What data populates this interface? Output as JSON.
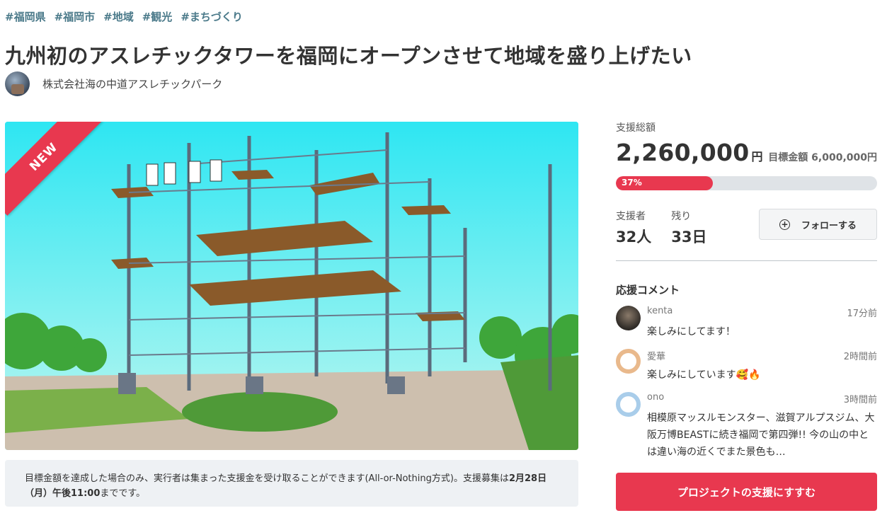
{
  "tags": [
    "#福岡県",
    "#福岡市",
    "#地域",
    "#観光",
    "#まちづくり"
  ],
  "title": "九州初のアスレチックタワーを福岡にオープンさせて地域を盛り上げたい",
  "owner": {
    "name": "株式会社海の中道アスレチックパーク"
  },
  "hero": {
    "badge": "NEW"
  },
  "notice": {
    "text_part1": "目標金額を達成した場合のみ、実行者は集まった支援金を受け取ることができます(All-or-Nothing方式)。支援募集は",
    "deadline": "2月28日（月）午後11:00",
    "text_part2": "までです。"
  },
  "funding": {
    "total_label": "支援総額",
    "total_amount": "2,260,000",
    "currency": "円",
    "goal_text": "目標金額 6,000,000円",
    "progress_percent": 37,
    "progress_label": "37%",
    "supporters_label": "支援者",
    "supporters_value": "32人",
    "remaining_label": "残り",
    "remaining_value": "33日",
    "follow_label": "フォローする"
  },
  "comments": {
    "title": "応援コメント",
    "items": [
      {
        "user": "kenta",
        "time": "17分前",
        "text": "楽しみにしてます！"
      },
      {
        "user": "愛華",
        "time": "2時間前",
        "text": "楽しみにしています🥰🔥"
      },
      {
        "user": "ono",
        "time": "3時間前",
        "text": "相模原マッスルモンスター、滋賀アルプスジム、大阪万博BEASTに続き福岡で第四弾!! 今の山の中とは違い海の近くでまた景色も…"
      }
    ]
  },
  "cta": {
    "label": "プロジェクトの支援にすすむ"
  },
  "colors": {
    "accent": "#e8384f",
    "tag": "#4b7a8a",
    "sky": "#2fe0ee"
  }
}
